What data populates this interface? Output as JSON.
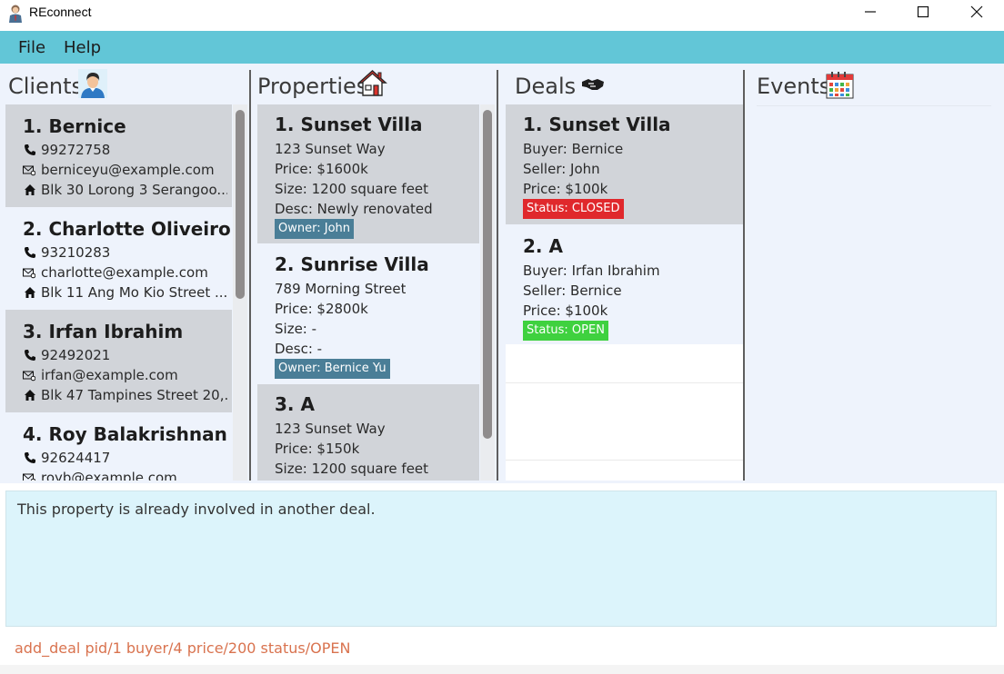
{
  "window": {
    "title": "REconnect",
    "icons": [
      "minimize-icon",
      "maximize-icon",
      "close-icon"
    ]
  },
  "menu": {
    "file": "File",
    "help": "Help"
  },
  "panels": {
    "clients": {
      "title": "Clients",
      "icon": "person-icon"
    },
    "properties": {
      "title": "Properties",
      "icon": "house-icon"
    },
    "deals": {
      "title": "Deals",
      "icon": "handshake-icon"
    },
    "events": {
      "title": "Events",
      "icon": "calendar-icon"
    }
  },
  "clients": [
    {
      "title": "1. Bernice",
      "phone": "99272758",
      "email": "berniceyu@example.com",
      "address": "Blk 30 Lorong 3 Serangoo..."
    },
    {
      "title": "2. Charlotte Oliveiro",
      "phone": "93210283",
      "email": "charlotte@example.com",
      "address": "Blk 11 Ang Mo Kio Street ..."
    },
    {
      "title": "3. Irfan Ibrahim",
      "phone": "92492021",
      "email": "irfan@example.com",
      "address": "Blk 47 Tampines Street 20,..."
    },
    {
      "title": "4. Roy Balakrishnan",
      "phone": "92624417",
      "email": "royb@example.com"
    }
  ],
  "properties": [
    {
      "title": "1. Sunset Villa",
      "address": "123 Sunset Way",
      "price": "Price: $1600k",
      "size": "Size: 1200 square feet",
      "desc": "Desc: Newly renovated",
      "owner": "Owner: John"
    },
    {
      "title": "2. Sunrise Villa",
      "address": "789 Morning Street",
      "price": "Price: $2800k",
      "size": "Size: -",
      "desc": "Desc: -",
      "owner": "Owner: Bernice Yu"
    },
    {
      "title": "3. A",
      "address": "123 Sunset Way",
      "price": "Price: $150k",
      "size": "Size: 1200 square feet"
    }
  ],
  "deals": [
    {
      "title": "1. Sunset Villa",
      "buyer": "Buyer: Bernice",
      "seller": "Seller: John",
      "price": "Price: $100k",
      "status": "Status: CLOSED",
      "status_color": "#e0282c"
    },
    {
      "title": "2. A",
      "buyer": "Buyer: Irfan Ibrahim",
      "seller": "Seller: Bernice",
      "price": "Price: $100k",
      "status": "Status: OPEN",
      "status_color": "#3fd13f"
    }
  ],
  "owner_tag_color": "#4a7e97",
  "result": {
    "message": "This property is already involved in another deal."
  },
  "command": {
    "value": "add_deal pid/1 buyer/4 price/200 status/OPEN"
  },
  "colors": {
    "menubar": "#62c6d7",
    "panel_bg": "#eef3fc",
    "card_grey": "#d1d4d9",
    "result_bg": "#dcf4fb",
    "command_text": "#d9734f"
  }
}
